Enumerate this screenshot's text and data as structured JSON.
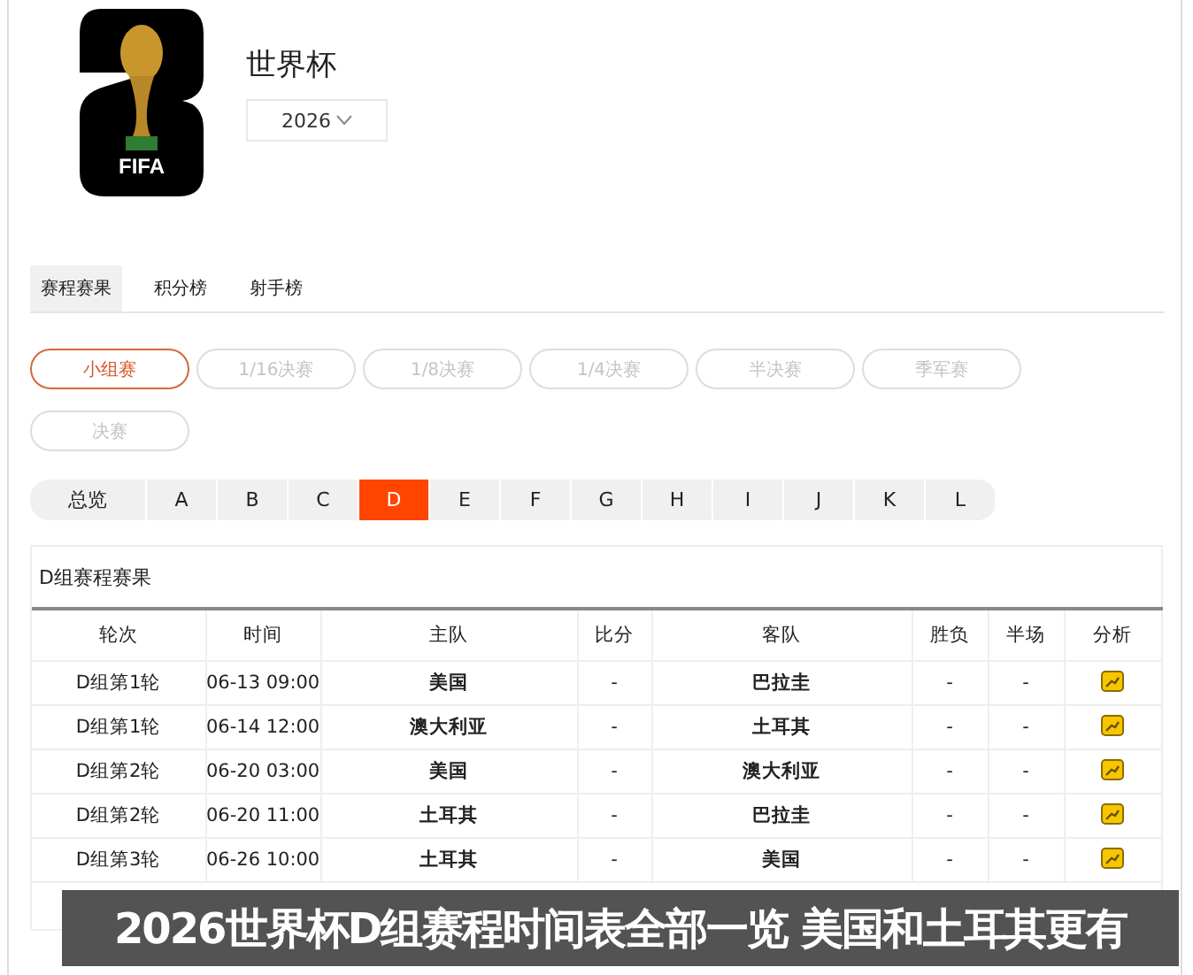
{
  "header": {
    "title": "世界杯",
    "logo_text": "FIFA",
    "season": "2026"
  },
  "tabs": [
    {
      "label": "赛程赛果",
      "selected": true
    },
    {
      "label": "积分榜",
      "selected": false
    },
    {
      "label": "射手榜",
      "selected": false
    }
  ],
  "stages": [
    {
      "label": "小组赛",
      "selected": true
    },
    {
      "label": "1/16决赛",
      "selected": false
    },
    {
      "label": "1/8决赛",
      "selected": false
    },
    {
      "label": "1/4决赛",
      "selected": false
    },
    {
      "label": "半决赛",
      "selected": false
    },
    {
      "label": "季军赛",
      "selected": false
    },
    {
      "label": "决赛",
      "selected": false
    }
  ],
  "groups": [
    {
      "label": "总览",
      "selected": false
    },
    {
      "label": "A",
      "selected": false
    },
    {
      "label": "B",
      "selected": false
    },
    {
      "label": "C",
      "selected": false
    },
    {
      "label": "D",
      "selected": true
    },
    {
      "label": "E",
      "selected": false
    },
    {
      "label": "F",
      "selected": false
    },
    {
      "label": "G",
      "selected": false
    },
    {
      "label": "H",
      "selected": false
    },
    {
      "label": "I",
      "selected": false
    },
    {
      "label": "J",
      "selected": false
    },
    {
      "label": "K",
      "selected": false
    },
    {
      "label": "L",
      "selected": false
    }
  ],
  "table": {
    "title": "D组赛程赛果",
    "columns": [
      "轮次",
      "时间",
      "主队",
      "比分",
      "客队",
      "胜负",
      "半场",
      "分析"
    ],
    "rows": [
      {
        "round": "D组第1轮",
        "time": "06-13 09:00",
        "home": "美国",
        "score": "-",
        "away": "巴拉圭",
        "result": "-",
        "half": "-"
      },
      {
        "round": "D组第1轮",
        "time": "06-14 12:00",
        "home": "澳大利亚",
        "score": "-",
        "away": "土耳其",
        "result": "-",
        "half": "-"
      },
      {
        "round": "D组第2轮",
        "time": "06-20 03:00",
        "home": "美国",
        "score": "-",
        "away": "澳大利亚",
        "result": "-",
        "half": "-"
      },
      {
        "round": "D组第2轮",
        "time": "06-20 11:00",
        "home": "土耳其",
        "score": "-",
        "away": "巴拉圭",
        "result": "-",
        "half": "-"
      },
      {
        "round": "D组第3轮",
        "time": "06-26 10:00",
        "home": "土耳其",
        "score": "-",
        "away": "美国",
        "result": "-",
        "half": "-"
      }
    ]
  },
  "caption_banner": "2026世界杯D组赛程时间表全部一览 美国和土耳其更有"
}
